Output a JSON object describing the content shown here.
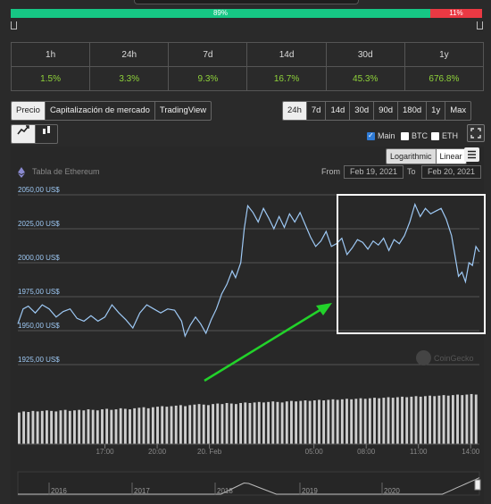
{
  "sentiment": {
    "up_label": "89%",
    "down_label": "11%",
    "up_value": 89,
    "down_value": 11,
    "up_color": "#16c784",
    "down_color": "#ea3943"
  },
  "performance": {
    "headers": [
      "1h",
      "24h",
      "7d",
      "14d",
      "30d",
      "1y"
    ],
    "values": [
      "1.5%",
      "3.3%",
      "9.3%",
      "16.7%",
      "45.3%",
      "676.8%"
    ],
    "value_color": "#8fd33a"
  },
  "view_tabs": [
    "Precio",
    "Capitalización de mercado",
    "TradingView"
  ],
  "view_active": "Precio",
  "range_tabs": [
    "24h",
    "7d",
    "14d",
    "30d",
    "90d",
    "180d",
    "1y",
    "Max"
  ],
  "range_active": "24h",
  "chart_type_icons": [
    "line-chart-icon",
    "candlestick-icon"
  ],
  "series_toggles": [
    {
      "label": "Main",
      "checked": true
    },
    {
      "label": "BTC",
      "checked": false
    },
    {
      "label": "ETH",
      "checked": false
    }
  ],
  "scale_tabs": [
    "Logarithmic",
    "Linear"
  ],
  "scale_active": "Linear",
  "chart_title": "Tabla de Ethereum",
  "date_range": {
    "from_label": "From",
    "from": "Feb 19, 2021",
    "to_label": "To",
    "to": "Feb 20, 2021"
  },
  "watermark": "CoinGecko",
  "chart_data": {
    "type": "line",
    "y_ticks": [
      "2050,00 US$",
      "2025,00 US$",
      "2000,00 US$",
      "1975,00 US$",
      "1950,00 US$",
      "1925,00 US$"
    ],
    "y_tick_values": [
      2050,
      2025,
      2000,
      1975,
      1950,
      1925
    ],
    "ylim": [
      1925,
      2050
    ],
    "x_ticks": [
      "17:00",
      "20:00",
      "20. Feb",
      "05:00",
      "08:00",
      "11:00",
      "14:00"
    ],
    "x_tick_hours": [
      5,
      8,
      11,
      17,
      20,
      23,
      26
    ],
    "xlim": [
      0,
      26.5
    ],
    "series": [
      {
        "line_color": "#9ec9f5",
        "points": [
          [
            0,
            1955
          ],
          [
            0.3,
            1966
          ],
          [
            0.6,
            1968
          ],
          [
            1,
            1963
          ],
          [
            1.4,
            1969
          ],
          [
            1.8,
            1966
          ],
          [
            2.2,
            1960
          ],
          [
            2.6,
            1964
          ],
          [
            3,
            1966
          ],
          [
            3.4,
            1959
          ],
          [
            3.8,
            1957
          ],
          [
            4.2,
            1961
          ],
          [
            4.6,
            1957
          ],
          [
            5,
            1960
          ],
          [
            5.4,
            1969
          ],
          [
            5.8,
            1963
          ],
          [
            6.2,
            1958
          ],
          [
            6.6,
            1952
          ],
          [
            7,
            1963
          ],
          [
            7.4,
            1969
          ],
          [
            7.8,
            1966
          ],
          [
            8.2,
            1963
          ],
          [
            8.6,
            1966
          ],
          [
            9,
            1965
          ],
          [
            9.4,
            1957
          ],
          [
            9.6,
            1946
          ],
          [
            9.9,
            1954
          ],
          [
            10.2,
            1960
          ],
          [
            10.5,
            1955
          ],
          [
            10.8,
            1948
          ],
          [
            11.1,
            1958
          ],
          [
            11.4,
            1966
          ],
          [
            11.7,
            1977
          ],
          [
            12,
            1984
          ],
          [
            12.3,
            1994
          ],
          [
            12.5,
            1989
          ],
          [
            12.8,
            2000
          ],
          [
            13,
            2025
          ],
          [
            13.2,
            2042
          ],
          [
            13.5,
            2037
          ],
          [
            13.8,
            2030
          ],
          [
            14.1,
            2040
          ],
          [
            14.4,
            2033
          ],
          [
            14.7,
            2025
          ],
          [
            15,
            2034
          ],
          [
            15.3,
            2026
          ],
          [
            15.6,
            2036
          ],
          [
            15.9,
            2030
          ],
          [
            16.2,
            2037
          ],
          [
            16.5,
            2028
          ],
          [
            16.8,
            2019
          ],
          [
            17.1,
            2012
          ],
          [
            17.4,
            2016
          ],
          [
            17.7,
            2023
          ],
          [
            18,
            2012
          ],
          [
            18.3,
            2014
          ],
          [
            18.6,
            2018
          ],
          [
            18.9,
            2006
          ],
          [
            19.2,
            2011
          ],
          [
            19.5,
            2017
          ],
          [
            19.8,
            2015
          ],
          [
            20.1,
            2010
          ],
          [
            20.4,
            2016
          ],
          [
            20.7,
            2013
          ],
          [
            21,
            2018
          ],
          [
            21.3,
            2009
          ],
          [
            21.6,
            2017
          ],
          [
            21.9,
            2014
          ],
          [
            22.2,
            2020
          ],
          [
            22.5,
            2030
          ],
          [
            22.8,
            2043
          ],
          [
            23.1,
            2034
          ],
          [
            23.4,
            2040
          ],
          [
            23.7,
            2036
          ],
          [
            24,
            2038
          ],
          [
            24.3,
            2040
          ],
          [
            24.6,
            2032
          ],
          [
            24.9,
            2020
          ],
          [
            25.1,
            2005
          ],
          [
            25.3,
            1990
          ],
          [
            25.5,
            1993
          ],
          [
            25.7,
            1986
          ],
          [
            25.9,
            2000
          ],
          [
            26.1,
            1998
          ],
          [
            26.3,
            2012
          ],
          [
            26.5,
            2008
          ]
        ]
      }
    ],
    "volume": [
      60,
      62,
      61,
      63,
      62,
      63,
      64,
      63,
      62,
      64,
      65,
      63,
      64,
      65,
      64,
      66,
      65,
      64,
      66,
      67,
      65,
      66,
      68,
      67,
      66,
      68,
      69,
      70,
      68,
      70,
      71,
      72,
      71,
      72,
      73,
      74,
      72,
      74,
      75,
      76,
      75,
      74,
      76,
      77,
      76,
      78,
      77,
      76,
      78,
      79,
      78,
      79,
      80,
      79,
      80,
      81,
      80,
      79,
      81,
      82,
      81,
      82,
      83,
      82,
      83,
      84,
      83,
      84,
      85,
      84,
      85,
      86,
      85,
      86,
      87,
      86,
      87,
      88,
      87,
      88,
      89,
      88,
      89,
      90,
      89,
      90,
      91,
      90,
      91,
      92,
      91,
      92,
      93,
      92,
      93,
      94,
      93,
      94,
      95,
      94
    ],
    "navigator_years": [
      "2016",
      "2017",
      "2018",
      "2019",
      "2020"
    ]
  }
}
